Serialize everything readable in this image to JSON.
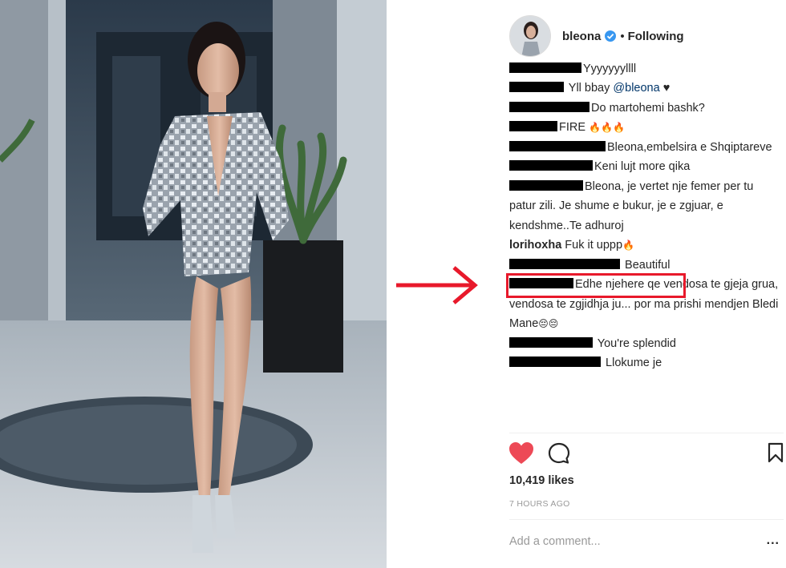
{
  "post": {
    "username": "bleona",
    "separator": "•",
    "follow_status": "Following"
  },
  "comments": [
    {
      "redacted": true,
      "text": "Yyyyyyyllll"
    },
    {
      "redacted": true,
      "text": "Yll bbay ",
      "mention": "@bleona",
      "emoji": "♥"
    },
    {
      "redacted": true,
      "text": "Do martohemi bashk?"
    },
    {
      "redacted": true,
      "text": "FIRE",
      "emoji": "🔥🔥🔥"
    },
    {
      "redacted": true,
      "text": "Bleona,embelsira e Shqiptareve"
    },
    {
      "redacted": true,
      "text": "Keni lujt more qika"
    },
    {
      "redacted": true,
      "text": "Bleona, je vertet nje femer per tu patur zili. Je shume e bukur, je e zgjuar, e kendshme..Te adhuroj"
    },
    {
      "redacted": false,
      "user": "lorihoxha",
      "text": "Fuk it uppp",
      "emoji": "🔥"
    },
    {
      "redacted": true,
      "text": "Beautiful"
    },
    {
      "redacted": true,
      "text": "Edhe njehere qe vendosa te gjeja grua, vendosa te zgjidhja ju... por ma prishi mendjen Bledi Mane",
      "emoji": "😔😔"
    },
    {
      "redacted": true,
      "text": "You're splendid"
    },
    {
      "redacted": true,
      "text": "Llokume je"
    }
  ],
  "actions": {
    "like_icon": "heart-filled-icon",
    "comment_icon": "comment-bubble-icon",
    "save_icon": "bookmark-icon"
  },
  "likes": "10,419 likes",
  "timestamp": "7 HOURS AGO",
  "add_comment_placeholder": "Add a comment...",
  "more_label": "...",
  "colors": {
    "like_red": "#ed4956",
    "highlight_red": "#e8192b",
    "verified_blue": "#3897f0",
    "mention_blue": "#003569",
    "muted_gray": "#999999"
  }
}
